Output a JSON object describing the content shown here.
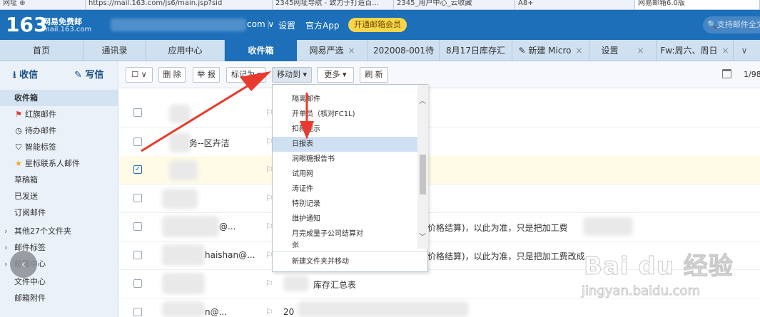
{
  "browser": {
    "tabs": [
      "网址 ⊕ ",
      "https://mail.163.com/js6/main.jsp?sid",
      "2345网址导航 - 致力于打造百...",
      "2345_用户中心_云收藏",
      "A8+",
      "网易邮箱6.0版"
    ]
  },
  "header": {
    "logo_number": "163",
    "logo_title": "网易免费邮",
    "logo_domain": "mail.163.com",
    "account_suffix": "com ∨",
    "links": [
      "设置",
      "官方App"
    ],
    "vip_button": "开通邮箱会员",
    "search_placeholder": "支持邮件全文"
  },
  "tabs": {
    "items": [
      {
        "label": "首页"
      },
      {
        "label": "通讯录"
      },
      {
        "label": "应用中心"
      },
      {
        "label": "收件箱"
      },
      {
        "label": "网易严选"
      },
      {
        "label": "202008-001待"
      },
      {
        "label": "8月17日库存汇"
      },
      {
        "label": "新建 Micro"
      },
      {
        "label": "设置"
      },
      {
        "label": "Fw:周六、周日"
      }
    ],
    "close_glyph": "×",
    "more_glyph": "∨"
  },
  "sidebar": {
    "receive": "收信",
    "write": "写信",
    "items": [
      {
        "label": "收件箱"
      },
      {
        "label": "红旗邮件"
      },
      {
        "label": "待办邮件"
      },
      {
        "label": "智能标签"
      },
      {
        "label": "星标联系人邮件"
      },
      {
        "label": "草稿箱"
      },
      {
        "label": "已发送"
      },
      {
        "label": "订阅邮件"
      },
      {
        "label": "其他27个文件夹"
      },
      {
        "label": "邮件标签"
      },
      {
        "label": "邮箱中心"
      },
      {
        "label": "文件中心"
      },
      {
        "label": "邮箱附件"
      }
    ]
  },
  "toolbar": {
    "select": "∨",
    "delete": "删 除",
    "report": "举 报",
    "mark_as": "标记为",
    "move_to": "移动到",
    "more": "更多",
    "refresh": "刷 新",
    "page": "1/98"
  },
  "list": {
    "rows": [
      {
        "sender": "",
        "subject": "",
        "checked": false
      },
      {
        "sender": "",
        "subject": "务--区卉洁",
        "checked": false
      },
      {
        "sender": "",
        "subject": "",
        "checked": true
      },
      {
        "sender": "",
        "subject": "",
        "checked": false
      },
      {
        "sender": "@...",
        "subject": "价格结算)，以此为准，只是把加工费",
        "checked": false
      },
      {
        "sender": "haishan@...",
        "subject": "价格结算)，以此为准，只是把加工费改成",
        "checked": false
      },
      {
        "sender": "",
        "subject": "库存汇总表",
        "checked": false
      },
      {
        "sender": "n@...",
        "subject": "20",
        "checked": false
      }
    ],
    "flag_glyph": "⚐"
  },
  "dropdown": {
    "items": [
      "隔离邮件",
      "开单员（核对FC1L)",
      "扣款提示",
      "日报表",
      "润眼糖报告书",
      "试用网",
      "涛证件",
      "特别记录",
      "维护通知",
      "月完成量子公司结算对",
      "张"
    ],
    "highlighted_index": 3,
    "new_folder": "新建文件夹并移动"
  },
  "watermark": {
    "main": "Bai du 经验",
    "sub": "jingyan.baidu.com"
  },
  "colors": {
    "brand_blue": "#1c6fb8",
    "vip_yellow": "#f8d54a",
    "arrow_red": "#e83a2e",
    "selected_row": "#fffbe6"
  }
}
